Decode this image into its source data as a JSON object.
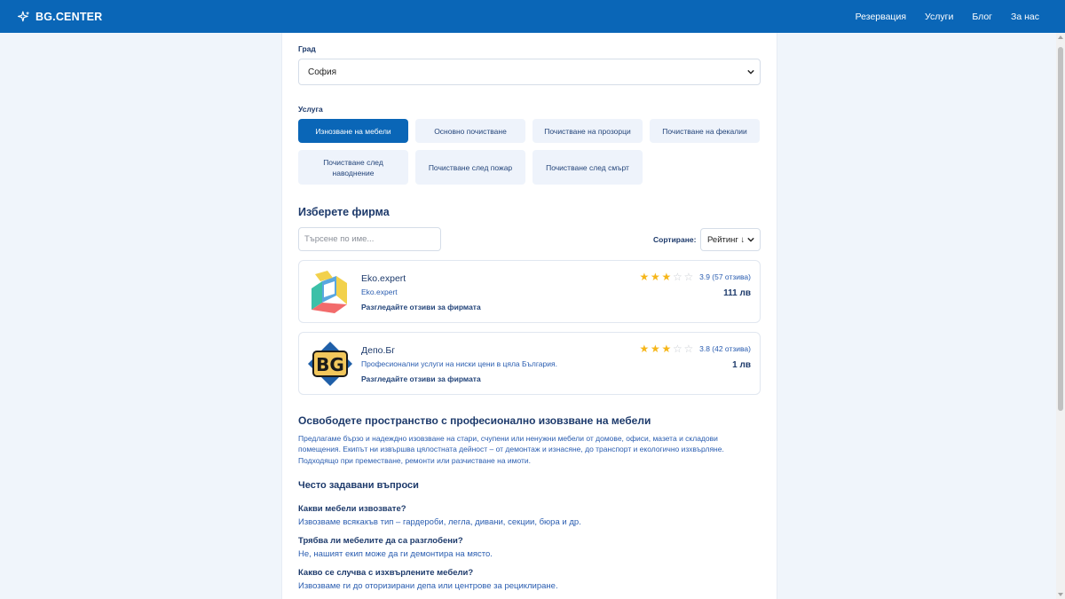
{
  "header": {
    "brand": "BG.CENTER",
    "nav": [
      "Резервация",
      "Услуги",
      "Блог",
      "За нас"
    ]
  },
  "form": {
    "city_label": "Град",
    "city_value": "София",
    "service_label": "Услуга",
    "services": [
      "Изнозване на мебели",
      "Основно почистване",
      "Почистване на прозорци",
      "Почистване на фекалии",
      "Почистване след наводнение",
      "Почистване след пожар",
      "Почистване след смърт"
    ],
    "active_service": 0
  },
  "firms_section": {
    "title": "Изберете фирма",
    "search_placeholder": "Търсене по име...",
    "sort_label": "Сортиране:",
    "sort_value": "Рейтинг ↓"
  },
  "firms": [
    {
      "name": "Eko.expert",
      "description": "Eko.expert",
      "reviews_link": "Разгледайте отзиви за фирмата",
      "stars_filled": 3,
      "stars_total": 5,
      "rating_text": "3.9 (57 отзива)",
      "price": "111 лв",
      "logo_text": ""
    },
    {
      "name": "Депо.Бг",
      "description": "Професионални услуги на ниски цени в цяла България.",
      "reviews_link": "Разгледайте отзиви за фирмата",
      "stars_filled": 3,
      "stars_total": 5,
      "rating_text": "3.8 (42 отзива)",
      "price": "1 лв",
      "logo_text": "BG"
    }
  ],
  "info": {
    "title": "Освободете пространство с професионално изовзване на мебели",
    "text": "Предлагаме бързо и надеждно изовзване на стари, счупени или ненужни мебели от домове, офиси, мазета и складови помещения. Екипът ни извършва цялостната дейност – от демонтаж и изнасяне, до транспорт и екологично изхвърляне. Подходящо при преместване, ремонти или разчистване на имоти."
  },
  "faq": {
    "title": "Често задавани въпроси",
    "items": [
      {
        "q": "Какви мебели извозвате?",
        "a": "Извозваме всякакъв тип – гардероби, легла, дивани, секции, бюра и др."
      },
      {
        "q": "Трябва ли мебелите да са разглобени?",
        "a": "Не, нашият екип може да ги демонтира на място."
      },
      {
        "q": "Какво се случва с изхвърлените мебели?",
        "a": "Извозваме ги до оторизирани депа или центрове за рециклиране."
      }
    ]
  },
  "colors": {
    "primary": "#0a66b7",
    "star": "#f6b619",
    "text_dark": "#1d3a6b",
    "link": "#2a5db0"
  },
  "icons": {
    "brand": "sparkle-icon",
    "select": "chevron-down-icon",
    "star": "star-icon"
  }
}
